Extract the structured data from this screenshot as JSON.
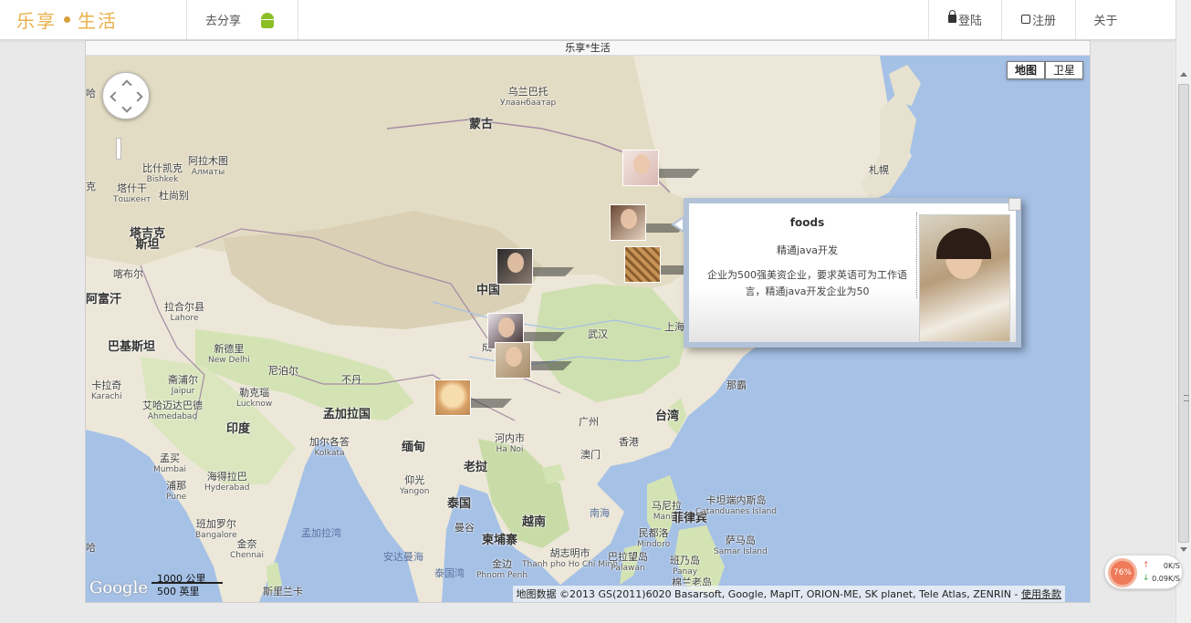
{
  "navbar": {
    "brand": "乐享",
    "brand_suffix": "生活",
    "share": "去分享",
    "login": "登陆",
    "register": "注册",
    "about": "关于"
  },
  "map": {
    "title": "乐享*生活",
    "type_map": "地图",
    "type_satellite": "卫星",
    "places": {
      "mongolia": "蒙古",
      "ulaanbaatar": "乌兰巴托",
      "ulaanbaatar_sub": "Улаанбаатар",
      "almaty": "阿拉木图",
      "almaty_sub": "Алматы",
      "bishkek": "比什凯克",
      "bishkek_sub": "Bishkek",
      "tashkent": "塔什干",
      "tashkent_sub": "Тошкент",
      "dushanbe": "杜尚别",
      "tajik": "塔吉克",
      "tajik2": "斯坦",
      "kabul": "喀布尔",
      "afghan": "阿富汗",
      "lahore": "拉合尔县",
      "lahore_sub": "Lahore",
      "pakistan": "巴基斯坦",
      "delhi": "新德里",
      "delhi_sub": "New Delhi",
      "karachi": "卡拉奇",
      "karachi_sub": "Karachi",
      "jaipur": "斋浦尔",
      "jaipur_sub": "Jaipur",
      "lucknow": "勒克瑙",
      "lucknow_sub": "Lucknow",
      "ahmedabad": "艾哈迈达巴德",
      "ahmedabad_sub": "Ahmedabad",
      "nepal": "尼泊尔",
      "bhutan": "不丹",
      "india": "印度",
      "bangladesh": "孟加拉国",
      "kolkata": "加尔各答",
      "kolkata_sub": "Kolkata",
      "mumbai": "孟买",
      "mumbai_sub": "Mumbai",
      "pune": "浦那",
      "pune_sub": "Pune",
      "hyderabad": "海得拉巴",
      "hyderabad_sub": "Hyderabad",
      "bangalore": "班加罗尔",
      "bangalore_sub": "Bangalore",
      "chennai": "金奈",
      "chennai_sub": "Chennai",
      "bengal_bay": "孟加拉湾",
      "myanmar": "缅甸",
      "yangon": "仰光",
      "yangon_sub": "Yangon",
      "andaman": "安达曼海",
      "laos": "老挝",
      "hanoi": "河内市",
      "hanoi_sub": "Ha Noi",
      "thailand": "泰国",
      "bangkok": "曼谷",
      "cambodia": "柬埔寨",
      "phnompenh": "金边",
      "phnompenh_sub": "Phnom Penh",
      "vietnam": "越南",
      "hcm": "胡志明市",
      "hcm_sub": "Thanh pho Ho Chi Minh",
      "thai_gulf": "泰国湾",
      "china": "中国",
      "chengdu": "成",
      "wuhan": "武汉",
      "shanghai": "上海",
      "guangzhou": "广州",
      "hongkong": "香港",
      "macau": "澳门",
      "taiwan": "台湾",
      "nanhai": "南海",
      "naha": "那霸",
      "sapporo": "札幌",
      "philippines": "菲律宾",
      "manila": "马尼拉",
      "manila_sub": "Manila",
      "mindoro": "民都洛",
      "mindoro_sub": "Mindoro",
      "catanduanes": "卡坦端内斯岛",
      "catanduanes_sub": "Catanduanes Island",
      "samar": "萨马岛",
      "samar_sub": "Samar Island",
      "palawan": "巴拉望岛",
      "palawan_sub": "Palawan",
      "panay": "班乃岛",
      "panay_sub": "Panay",
      "mindanao": "棉兰老岛",
      "srilanka": "斯里兰卡",
      "ha": "哈",
      "ke": "克",
      "ha2": "哈"
    },
    "info": {
      "name": "foods",
      "skill": "精通java开发",
      "desc": "企业为500强美资企业，要求英语可为工作语言，精通java开发企业为50"
    },
    "google": "Google",
    "scale_km": "1000 公里",
    "scale_mi": "500 英里",
    "attribution": "地图数据 ©2013 GS(2011)6020 Basarsoft, Google, MapIT, ORION-ME, SK planet, Tele Atlas, ZENRIN - ",
    "terms": "使用条款"
  },
  "net": {
    "percent": "76%",
    "up": "0K/S",
    "down": "0.09K/S"
  }
}
